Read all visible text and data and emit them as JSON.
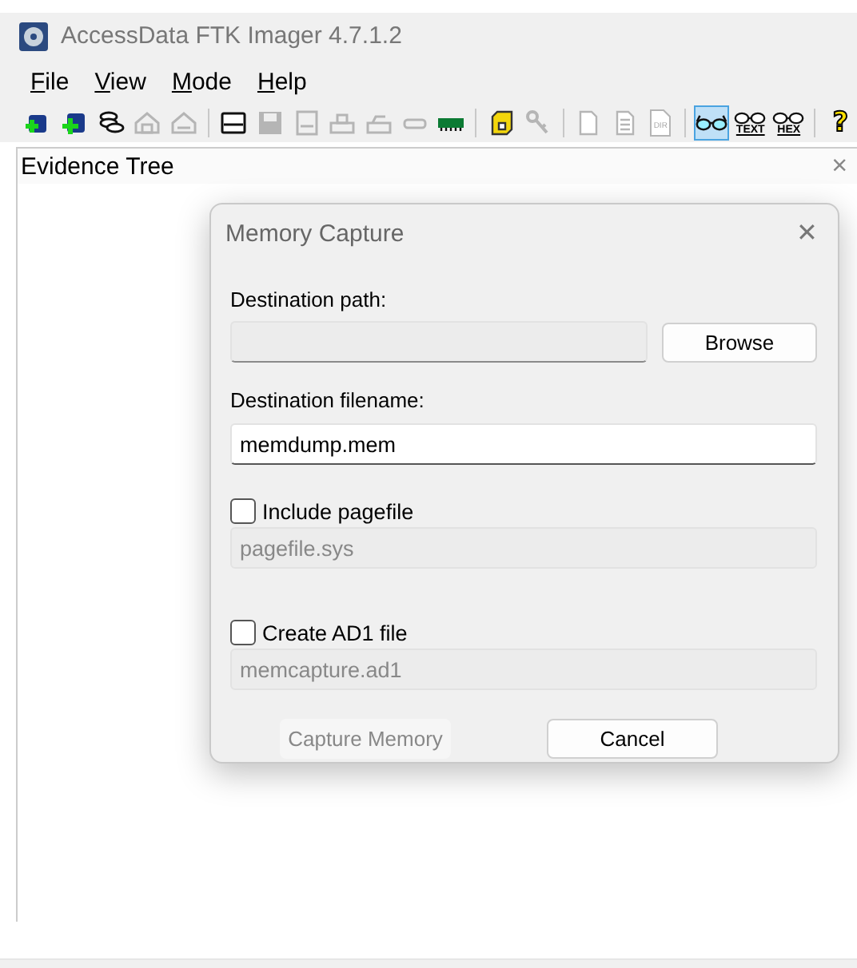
{
  "window": {
    "title": "AccessData FTK Imager 4.7.1.2"
  },
  "menu": [
    {
      "label": "File",
      "mnemonic_underlined": true
    },
    {
      "label": "View",
      "mnemonic_underlined": true
    },
    {
      "label": "Mode",
      "mnemonic_underlined": true
    },
    {
      "label": "Help",
      "mnemonic_underlined": true
    }
  ],
  "toolbar": [
    {
      "kind": "button",
      "disabled": false,
      "selected": false
    },
    {
      "kind": "button",
      "disabled": false,
      "selected": false
    },
    {
      "kind": "button",
      "disabled": false,
      "selected": false
    },
    {
      "kind": "button",
      "disabled": true,
      "selected": false
    },
    {
      "kind": "button",
      "disabled": true,
      "selected": false
    },
    {
      "kind": "separator"
    },
    {
      "kind": "button",
      "disabled": false,
      "selected": false
    },
    {
      "kind": "button",
      "disabled": true,
      "selected": false
    },
    {
      "kind": "button",
      "disabled": true,
      "selected": false
    },
    {
      "kind": "button",
      "disabled": true,
      "selected": false
    },
    {
      "kind": "button",
      "disabled": true,
      "selected": false
    },
    {
      "kind": "button",
      "disabled": true,
      "selected": false
    },
    {
      "kind": "button",
      "disabled": false,
      "selected": false
    },
    {
      "kind": "separator"
    },
    {
      "kind": "button",
      "disabled": false,
      "selected": false
    },
    {
      "kind": "button",
      "disabled": true,
      "selected": false
    },
    {
      "kind": "separator"
    },
    {
      "kind": "button",
      "disabled": true,
      "selected": false
    },
    {
      "kind": "button",
      "disabled": true,
      "selected": false
    },
    {
      "kind": "button",
      "disabled": true,
      "selected": false,
      "label": "DIR"
    },
    {
      "kind": "separator"
    },
    {
      "kind": "button",
      "disabled": false,
      "selected": true
    },
    {
      "kind": "button",
      "disabled": false,
      "selected": false,
      "label": "TEXT"
    },
    {
      "kind": "button",
      "disabled": false,
      "selected": false,
      "label": "HEX"
    },
    {
      "kind": "separator"
    },
    {
      "kind": "button",
      "disabled": false,
      "selected": false,
      "label": "?"
    }
  ],
  "panel": {
    "title": "Evidence Tree",
    "close": "×"
  },
  "dialog": {
    "title": "Memory Capture",
    "close": "✕",
    "destination_path": {
      "label": "Destination path:",
      "disabled": true
    },
    "browse_button": {
      "label": "Browse",
      "disabled": false
    },
    "destination_filename": {
      "label": "Destination filename:",
      "value": "memdump.mem",
      "disabled": false
    },
    "include_pagefile": {
      "label": "Include pagefile",
      "checked": false,
      "field": {
        "value": "pagefile.sys",
        "disabled": true
      }
    },
    "create_ad1": {
      "label": "Create AD1 file",
      "checked": false,
      "field": {
        "value": "memcapture.ad1",
        "disabled": true
      }
    },
    "buttons": [
      {
        "label": "Capture Memory",
        "disabled": true
      },
      {
        "label": "Cancel",
        "disabled": false
      }
    ]
  }
}
